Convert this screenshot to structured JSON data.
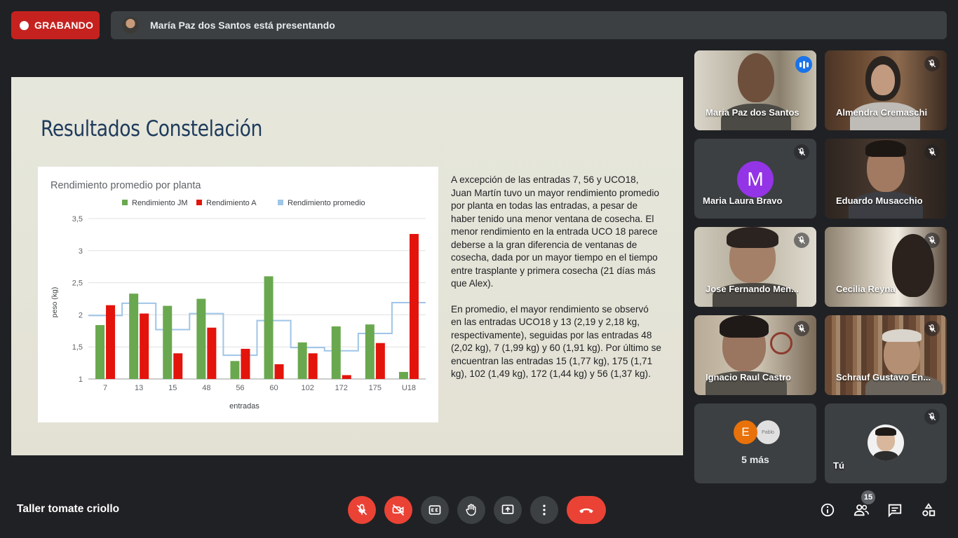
{
  "recording": {
    "label": "GRABANDO"
  },
  "presenting": {
    "text": "María Paz dos Santos está presentando"
  },
  "slide": {
    "title": "Resultados Constelación",
    "paragraphs": [
      "A excepción de las entradas 7, 56 y UCO18, Juan Martín tuvo un mayor rendimiento promedio por planta en todas las entradas, a pesar de haber tenido una menor ventana de cosecha. El menor rendimiento en la entrada UCO 18 parece deberse a la gran diferencia de ventanas de cosecha, dada por un mayor tiempo en el tiempo entre trasplante y primera cosecha (21 días más que Alex).",
      "En promedio, el mayor rendimiento se observó en las entradas UCO18 y 13 (2,19 y 2,18 kg, respectivamente), seguidas por las entradas 48 (2,02 kg), 7 (1,99 kg) y 60 (1,91 kg). Por último se encuentran las entradas 15 (1,77 kg), 175 (1,71 kg), 102 (1,49 kg), 172 (1,44 kg) y 56 (1,37 kg)."
    ]
  },
  "chart_data": {
    "type": "bar",
    "title": "Rendimiento promedio por planta",
    "xlabel": "entradas",
    "ylabel": "peso (kg)",
    "ylim": [
      1,
      3.5
    ],
    "yticks": [
      "1",
      "1,5",
      "2",
      "2,5",
      "3",
      "3,5"
    ],
    "ytick_values": [
      1,
      1.5,
      2,
      2.5,
      3,
      3.5
    ],
    "categories": [
      "7",
      "13",
      "15",
      "48",
      "56",
      "60",
      "102",
      "172",
      "175",
      "U18"
    ],
    "series": [
      {
        "name": "Rendimiento JM",
        "type": "bar",
        "color": "#6aa84f",
        "values": [
          1.84,
          2.33,
          2.14,
          2.25,
          1.28,
          2.6,
          1.57,
          1.82,
          1.85,
          1.11
        ]
      },
      {
        "name": "Rendimiento A",
        "type": "bar",
        "color": "#e3140c",
        "values": [
          2.15,
          2.02,
          1.4,
          1.8,
          1.47,
          1.23,
          1.4,
          1.06,
          1.56,
          3.26
        ]
      },
      {
        "name": "Rendimiento promedio",
        "type": "step",
        "color": "#9fc5e8",
        "values": [
          1.99,
          2.18,
          1.77,
          2.02,
          1.37,
          1.91,
          1.49,
          1.44,
          1.71,
          2.19
        ]
      }
    ],
    "legend_position": "top",
    "grid": true
  },
  "participants": [
    {
      "name": "María Paz dos Santos",
      "speaking": true
    },
    {
      "name": "Almendra Cremaschi",
      "muted": true
    },
    {
      "name": "Maria Laura Bravo",
      "muted": true,
      "initial": "M"
    },
    {
      "name": "Eduardo Musacchio",
      "muted": true
    },
    {
      "name": "Jose Fernando Men...",
      "muted": true
    },
    {
      "name": "Cecilia Reyna",
      "muted": true
    },
    {
      "name": "Ignacio Raul Castro",
      "muted": true
    },
    {
      "name": "Schrauf Gustavo En...",
      "muted": true
    },
    {
      "more_initial": "E",
      "more_small": "Pablo",
      "more_label": "5 más"
    },
    {
      "name": "Tú",
      "muted": true
    }
  ],
  "meeting": {
    "title": "Taller tomate criollo",
    "participant_count": "15"
  },
  "icons": {
    "mic": "mic-off-icon",
    "camera": "camera-off-icon",
    "captions": "captions-icon",
    "hand": "raise-hand-icon",
    "present": "present-screen-icon",
    "more": "more-vert-icon",
    "hangup": "hangup-icon",
    "info": "info-icon",
    "people": "people-icon",
    "chat": "chat-icon",
    "activities": "activities-icon"
  },
  "colors": {
    "recording": "#c5221f",
    "danger": "#ea4335",
    "speaking": "#1a73e8",
    "active_border": "#8ab4f8",
    "avatar_m": "#9334e6",
    "avatar_e": "#e8710a"
  }
}
